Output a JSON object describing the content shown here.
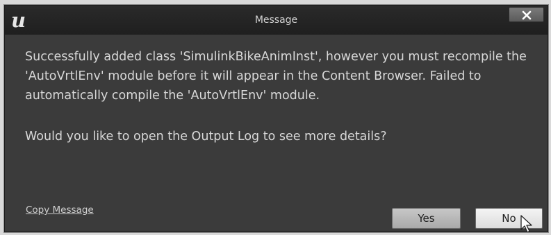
{
  "window": {
    "title": "Message",
    "logo_text": "u"
  },
  "message": {
    "body": "Successfully added class 'SimulinkBikeAnimInst', however you must recompile the 'AutoVrtlEnv' module before it will appear in the Content Browser. Failed to automatically compile the 'AutoVrtlEnv' module.",
    "question": "Would you like to open the Output Log to see more details?"
  },
  "footer": {
    "copy_label": "Copy Message",
    "yes_label": "Yes",
    "no_label": "No"
  },
  "icons": {
    "logo": "unreal-logo-icon",
    "close": "close-icon",
    "cursor": "mouse-pointer-icon"
  },
  "colors": {
    "dialog_bg": "#3b3b3b",
    "titlebar_bg": "#222222",
    "text": "#d8d8d8"
  }
}
